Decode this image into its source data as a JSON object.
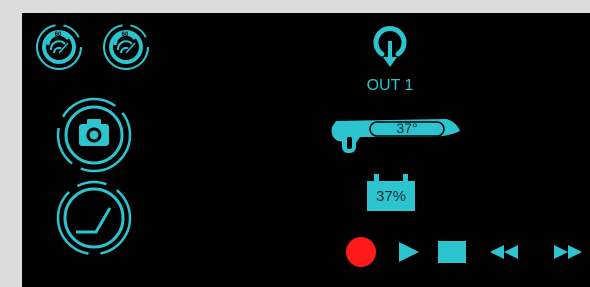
{
  "colors": {
    "accent": "#2bc4cf",
    "accent_dark": "#137e87",
    "background": "#000000",
    "frame": "#dcdcdc",
    "record": "#ff1a1a"
  },
  "left_panel": {
    "sensor_buttons": [
      {
        "icon": "speed-gauge-icon",
        "badge": "60"
      },
      {
        "icon": "speed-gauge-icon",
        "badge": "60"
      }
    ],
    "camera_button": {
      "icon": "camera-icon"
    },
    "angle_button": {
      "icon": "angle-gauge-icon"
    }
  },
  "output": {
    "icon": "power-output-icon",
    "label": "OUT 1"
  },
  "probe": {
    "icon": "probe-icon",
    "temperature": "37°"
  },
  "battery": {
    "icon": "battery-icon",
    "level_text": "37%",
    "level": 0.37
  },
  "transport": {
    "record": "record-icon",
    "play": "play-icon",
    "stop": "stop-icon",
    "rewind": "rewind-icon",
    "fast_forward": "fast-forward-icon"
  }
}
